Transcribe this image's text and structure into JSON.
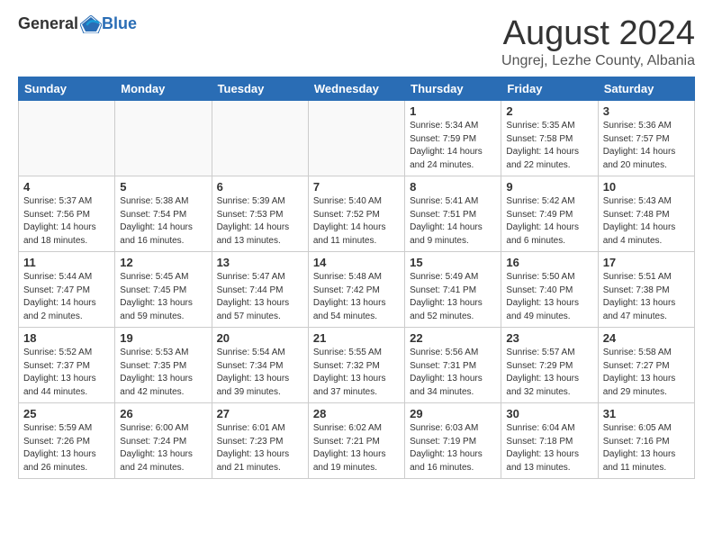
{
  "header": {
    "logo_general": "General",
    "logo_blue": "Blue",
    "month_title": "August 2024",
    "location": "Ungrej, Lezhe County, Albania"
  },
  "days_of_week": [
    "Sunday",
    "Monday",
    "Tuesday",
    "Wednesday",
    "Thursday",
    "Friday",
    "Saturday"
  ],
  "weeks": [
    [
      {
        "day": "",
        "info": "",
        "empty": true
      },
      {
        "day": "",
        "info": "",
        "empty": true
      },
      {
        "day": "",
        "info": "",
        "empty": true
      },
      {
        "day": "",
        "info": "",
        "empty": true
      },
      {
        "day": "1",
        "info": "Sunrise: 5:34 AM\nSunset: 7:59 PM\nDaylight: 14 hours\nand 24 minutes.",
        "empty": false
      },
      {
        "day": "2",
        "info": "Sunrise: 5:35 AM\nSunset: 7:58 PM\nDaylight: 14 hours\nand 22 minutes.",
        "empty": false
      },
      {
        "day": "3",
        "info": "Sunrise: 5:36 AM\nSunset: 7:57 PM\nDaylight: 14 hours\nand 20 minutes.",
        "empty": false
      }
    ],
    [
      {
        "day": "4",
        "info": "Sunrise: 5:37 AM\nSunset: 7:56 PM\nDaylight: 14 hours\nand 18 minutes.",
        "empty": false
      },
      {
        "day": "5",
        "info": "Sunrise: 5:38 AM\nSunset: 7:54 PM\nDaylight: 14 hours\nand 16 minutes.",
        "empty": false
      },
      {
        "day": "6",
        "info": "Sunrise: 5:39 AM\nSunset: 7:53 PM\nDaylight: 14 hours\nand 13 minutes.",
        "empty": false
      },
      {
        "day": "7",
        "info": "Sunrise: 5:40 AM\nSunset: 7:52 PM\nDaylight: 14 hours\nand 11 minutes.",
        "empty": false
      },
      {
        "day": "8",
        "info": "Sunrise: 5:41 AM\nSunset: 7:51 PM\nDaylight: 14 hours\nand 9 minutes.",
        "empty": false
      },
      {
        "day": "9",
        "info": "Sunrise: 5:42 AM\nSunset: 7:49 PM\nDaylight: 14 hours\nand 6 minutes.",
        "empty": false
      },
      {
        "day": "10",
        "info": "Sunrise: 5:43 AM\nSunset: 7:48 PM\nDaylight: 14 hours\nand 4 minutes.",
        "empty": false
      }
    ],
    [
      {
        "day": "11",
        "info": "Sunrise: 5:44 AM\nSunset: 7:47 PM\nDaylight: 14 hours\nand 2 minutes.",
        "empty": false
      },
      {
        "day": "12",
        "info": "Sunrise: 5:45 AM\nSunset: 7:45 PM\nDaylight: 13 hours\nand 59 minutes.",
        "empty": false
      },
      {
        "day": "13",
        "info": "Sunrise: 5:47 AM\nSunset: 7:44 PM\nDaylight: 13 hours\nand 57 minutes.",
        "empty": false
      },
      {
        "day": "14",
        "info": "Sunrise: 5:48 AM\nSunset: 7:42 PM\nDaylight: 13 hours\nand 54 minutes.",
        "empty": false
      },
      {
        "day": "15",
        "info": "Sunrise: 5:49 AM\nSunset: 7:41 PM\nDaylight: 13 hours\nand 52 minutes.",
        "empty": false
      },
      {
        "day": "16",
        "info": "Sunrise: 5:50 AM\nSunset: 7:40 PM\nDaylight: 13 hours\nand 49 minutes.",
        "empty": false
      },
      {
        "day": "17",
        "info": "Sunrise: 5:51 AM\nSunset: 7:38 PM\nDaylight: 13 hours\nand 47 minutes.",
        "empty": false
      }
    ],
    [
      {
        "day": "18",
        "info": "Sunrise: 5:52 AM\nSunset: 7:37 PM\nDaylight: 13 hours\nand 44 minutes.",
        "empty": false
      },
      {
        "day": "19",
        "info": "Sunrise: 5:53 AM\nSunset: 7:35 PM\nDaylight: 13 hours\nand 42 minutes.",
        "empty": false
      },
      {
        "day": "20",
        "info": "Sunrise: 5:54 AM\nSunset: 7:34 PM\nDaylight: 13 hours\nand 39 minutes.",
        "empty": false
      },
      {
        "day": "21",
        "info": "Sunrise: 5:55 AM\nSunset: 7:32 PM\nDaylight: 13 hours\nand 37 minutes.",
        "empty": false
      },
      {
        "day": "22",
        "info": "Sunrise: 5:56 AM\nSunset: 7:31 PM\nDaylight: 13 hours\nand 34 minutes.",
        "empty": false
      },
      {
        "day": "23",
        "info": "Sunrise: 5:57 AM\nSunset: 7:29 PM\nDaylight: 13 hours\nand 32 minutes.",
        "empty": false
      },
      {
        "day": "24",
        "info": "Sunrise: 5:58 AM\nSunset: 7:27 PM\nDaylight: 13 hours\nand 29 minutes.",
        "empty": false
      }
    ],
    [
      {
        "day": "25",
        "info": "Sunrise: 5:59 AM\nSunset: 7:26 PM\nDaylight: 13 hours\nand 26 minutes.",
        "empty": false
      },
      {
        "day": "26",
        "info": "Sunrise: 6:00 AM\nSunset: 7:24 PM\nDaylight: 13 hours\nand 24 minutes.",
        "empty": false
      },
      {
        "day": "27",
        "info": "Sunrise: 6:01 AM\nSunset: 7:23 PM\nDaylight: 13 hours\nand 21 minutes.",
        "empty": false
      },
      {
        "day": "28",
        "info": "Sunrise: 6:02 AM\nSunset: 7:21 PM\nDaylight: 13 hours\nand 19 minutes.",
        "empty": false
      },
      {
        "day": "29",
        "info": "Sunrise: 6:03 AM\nSunset: 7:19 PM\nDaylight: 13 hours\nand 16 minutes.",
        "empty": false
      },
      {
        "day": "30",
        "info": "Sunrise: 6:04 AM\nSunset: 7:18 PM\nDaylight: 13 hours\nand 13 minutes.",
        "empty": false
      },
      {
        "day": "31",
        "info": "Sunrise: 6:05 AM\nSunset: 7:16 PM\nDaylight: 13 hours\nand 11 minutes.",
        "empty": false
      }
    ]
  ]
}
